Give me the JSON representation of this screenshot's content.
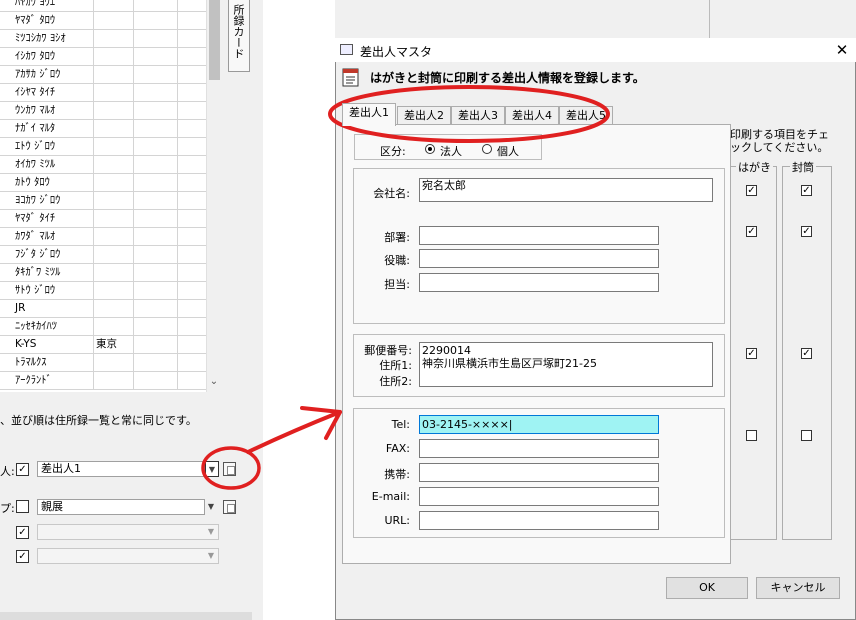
{
  "background_app": {
    "list_names": [
      "ﾊﾔｶﾜ ﾖｳｴ",
      "ﾔﾏﾀﾞ ﾀﾛｳ",
      "ﾐﾂｺｼｶﾜ ﾖｼｵ",
      "ｲｼｶﾜ ﾀﾛｳ",
      "ｱｶｻｶ ｼﾞﾛｳ",
      "ｲｼﾔﾏ ﾀｲﾁ",
      "ｳﾝｶﾜ ﾏﾙｵ",
      "ﾅｶﾞｲ ﾏﾙﾀ",
      "ｴﾄｳ ｼﾞﾛｳ",
      "ｵｲｶﾜ ﾐﾂﾙ",
      "ｶﾄｳ ﾀﾛｳ",
      "ﾖｺｶﾜ ｼﾞﾛｳ",
      "ﾔﾏﾀﾞ ﾀｲﾁ",
      "ｶﾜﾀﾞ ﾏﾙｵ",
      "ﾌｼﾞﾀ ｼﾞﾛｳ",
      "ﾀｷｶﾞﾜ ﾐﾂﾙ",
      "ｻﾄｳ ｼﾞﾛｳ",
      "JR",
      "ﾆｯｾｷｶｲﾊﾂ",
      "K-YS",
      "ﾄﾗﾏﾙｸｽ",
      "ｱｰｸﾗﾝﾄﾞ"
    ],
    "list_second_col": [
      "",
      "",
      "",
      "",
      "",
      "",
      "",
      "",
      "",
      "",
      "",
      "",
      "",
      "",
      "",
      "",
      "",
      "",
      "",
      "東京",
      "",
      ""
    ],
    "side_tab_label": "所録カード",
    "sort_note": "、並び順は住所録一覧と常に同じです。",
    "sender_row": {
      "label": "人:",
      "combo_value": "差出人1"
    },
    "group_row": {
      "label": "プ:",
      "combo_value": "親展"
    },
    "extra_rows": [
      "",
      ""
    ]
  },
  "dialog": {
    "title": "差出人マスタ",
    "close_glyph": "✕",
    "header_text": "はがきと封筒に印刷する差出人情報を登録します。",
    "tabs": [
      "差出人1",
      "差出人2",
      "差出人3",
      "差出人4",
      "差出人5"
    ],
    "active_tab_index": 0,
    "kubun": {
      "label": "区分:",
      "options": [
        "法人",
        "個人"
      ],
      "selected": "法人"
    },
    "fields": {
      "company": {
        "label": "会社名:",
        "value": "宛名太郎"
      },
      "department": {
        "label": "部署:",
        "value": ""
      },
      "position": {
        "label": "役職:",
        "value": ""
      },
      "person": {
        "label": "担当:",
        "value": ""
      },
      "postal_label": "郵便番号:",
      "address1_label": "住所1:",
      "address2_label": "住所2:",
      "postal_value": "2290014",
      "address1_value": "神奈川県横浜市生島区戸塚町21-25",
      "address2_value": "",
      "tel": {
        "label": "Tel:",
        "value": "03-2145-××××"
      },
      "fax": {
        "label": "FAX:",
        "value": ""
      },
      "mobile": {
        "label": "携帯:",
        "value": ""
      },
      "email": {
        "label": "E-mail:",
        "value": ""
      },
      "url": {
        "label": "URL:",
        "value": ""
      }
    },
    "print_check": {
      "instruction": "印刷する項目をチェックしてください。",
      "hagaki_label": "はがき",
      "futou_label": "封筒",
      "rows": [
        {
          "name": "company",
          "hagaki": true,
          "futou": true
        },
        {
          "name": "department",
          "hagaki": true,
          "futou": true
        },
        {
          "name": "address",
          "hagaki": true,
          "futou": true
        },
        {
          "name": "tel",
          "hagaki": false,
          "futou": false
        }
      ]
    },
    "buttons": {
      "ok": "OK",
      "cancel": "キャンセル"
    }
  },
  "annotation_color": "#e02020"
}
